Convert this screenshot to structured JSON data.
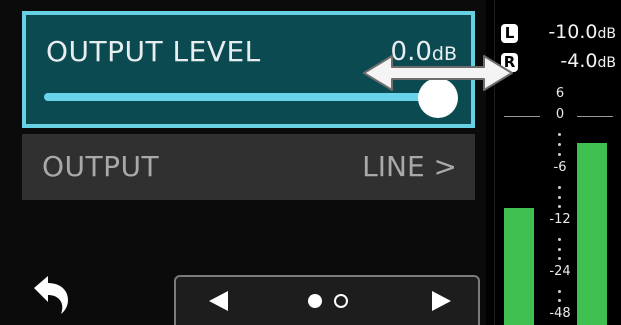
{
  "settings": {
    "output_level": {
      "label": "OUTPUT LEVEL",
      "value": "0.0",
      "unit": "dB",
      "slider_fraction": 1.0
    },
    "output": {
      "label": "OUTPUT",
      "value": "LINE >"
    }
  },
  "navigation": {
    "back_icon": "back-arrow-icon",
    "prev_icon": "triangle-left-icon",
    "next_icon": "triangle-right-icon",
    "pages": 2,
    "active_page": 1
  },
  "meter": {
    "left": {
      "badge": "L",
      "value": "-10.0",
      "unit": "dB",
      "level_fraction": 0.36
    },
    "right": {
      "badge": "R",
      "value": "-4.0",
      "unit": "dB",
      "level_fraction": 0.56
    },
    "scale": [
      "6",
      "0",
      "-6",
      "-12",
      "-24",
      "-48"
    ]
  },
  "colors": {
    "accent": "#67d0e2",
    "meter_green": "#3fbf4f",
    "selected_row": "#0c4a52"
  }
}
